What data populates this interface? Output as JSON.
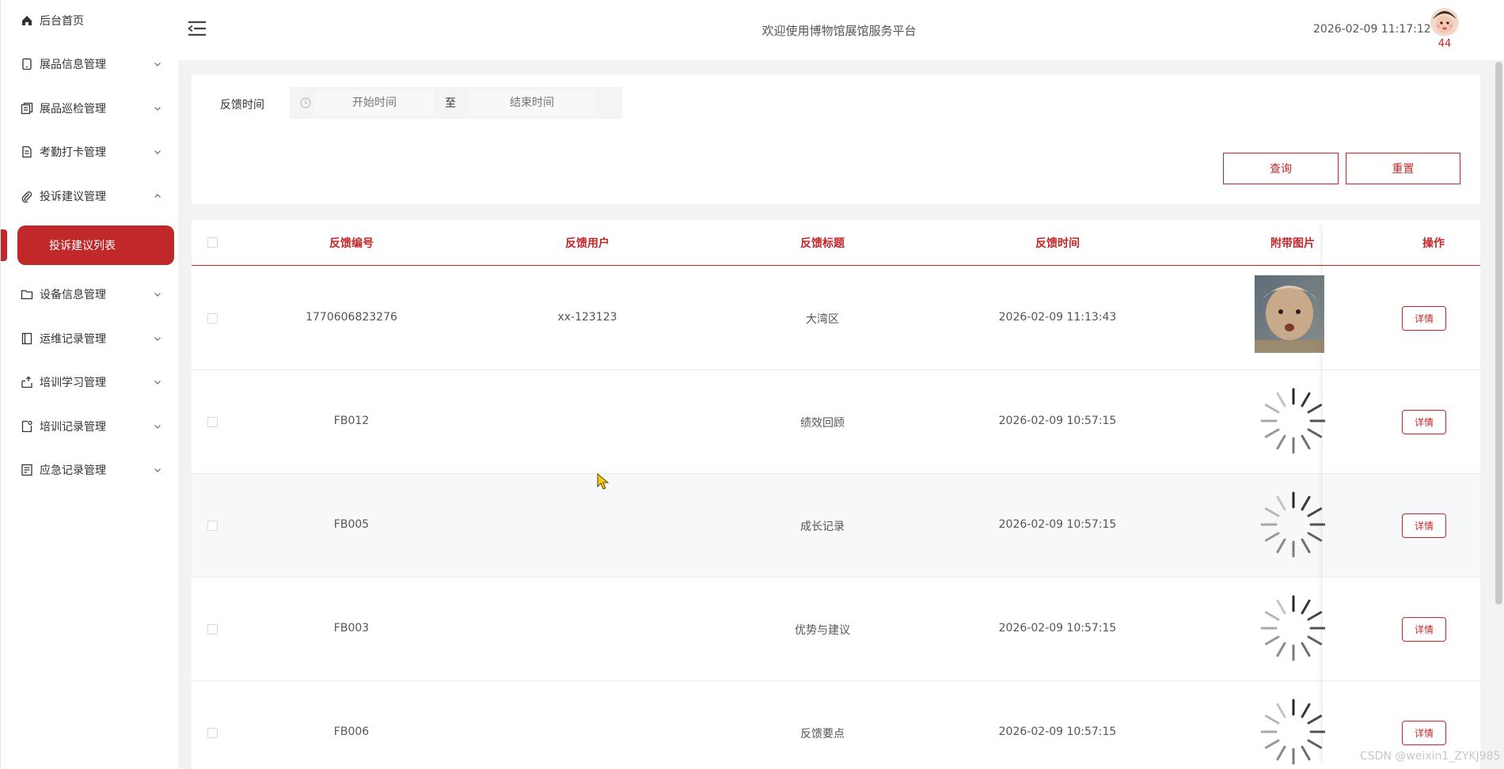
{
  "sidebar": {
    "items": [
      {
        "label": "后台首页",
        "icon": "home-icon"
      },
      {
        "label": "展品信息管理",
        "icon": "tablet-icon"
      },
      {
        "label": "展品巡检管理",
        "icon": "copy-icon"
      },
      {
        "label": "考勤打卡管理",
        "icon": "document-icon"
      },
      {
        "label": "投诉建议管理",
        "icon": "paperclip-icon"
      },
      {
        "label": "设备信息管理",
        "icon": "folder-icon"
      },
      {
        "label": "运维记录管理",
        "icon": "notebook-icon"
      },
      {
        "label": "培训学习管理",
        "icon": "upload-icon"
      },
      {
        "label": "培训记录管理",
        "icon": "file-icon"
      },
      {
        "label": "应急记录管理",
        "icon": "list-icon"
      }
    ],
    "active_sub": "投诉建议列表"
  },
  "header": {
    "title": "欢迎使用博物馆展馆服务平台",
    "datetime": "2026-02-09 11:17:12",
    "badge": "44"
  },
  "search": {
    "label": "反馈时间",
    "start_placeholder": "开始时间",
    "separator": "至",
    "end_placeholder": "结束时间",
    "query_label": "查询",
    "reset_label": "重置"
  },
  "table": {
    "headers": [
      "反馈编号",
      "反馈用户",
      "反馈标题",
      "反馈时间",
      "附带图片",
      "操作"
    ],
    "rows": [
      {
        "id": "1770606823276",
        "user": "xx-123123",
        "title": "大湾区",
        "time": "2026-02-09 11:13:43",
        "image": "loaded",
        "action": "详情"
      },
      {
        "id": "FB012",
        "user": "",
        "title": "绩效回顾",
        "time": "2026-02-09 10:57:15",
        "image": "loading",
        "action": "详情"
      },
      {
        "id": "FB005",
        "user": "",
        "title": "成长记录",
        "time": "2026-02-09 10:57:15",
        "image": "loading",
        "action": "详情"
      },
      {
        "id": "FB003",
        "user": "",
        "title": "优势与建议",
        "time": "2026-02-09 10:57:15",
        "image": "loading",
        "action": "详情"
      },
      {
        "id": "FB006",
        "user": "",
        "title": "反馈要点",
        "time": "2026-02-09 10:57:15",
        "image": "loading",
        "action": "详情"
      }
    ]
  },
  "watermark": "CSDN @weixin1_ZYKJ985",
  "colors": {
    "accent": "#c0282a",
    "text": "#333333",
    "muted": "#555555"
  }
}
